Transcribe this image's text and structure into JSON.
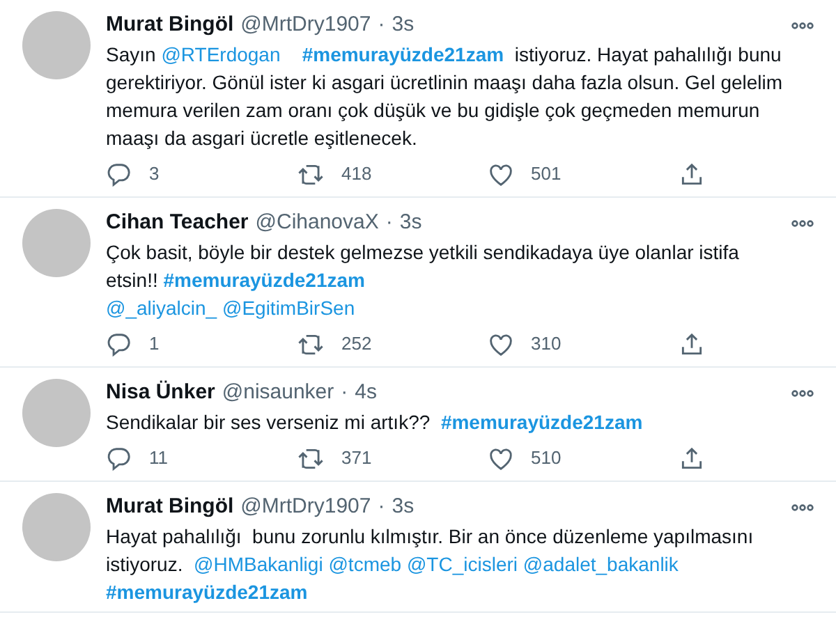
{
  "tweets": [
    {
      "name": "Murat Bingöl",
      "handle": "@MrtDry1907",
      "separator": "·",
      "time": "3s",
      "body": [
        {
          "kind": "text",
          "text": "Sayın "
        },
        {
          "kind": "mention",
          "text": "@RTErdogan"
        },
        {
          "kind": "hashtag",
          "text": "#memurayüzde21zam"
        },
        {
          "kind": "text",
          "text": "  istiyoruz. Hayat pahalılığı bunu gerektiriyor. Gönül ister ki asgari ücretlinin maaşı daha fazla olsun. Gel gelelim memura verilen zam oranı çok düşük ve bu gidişle çok geçmeden memurun maaşı da asgari ücretle eşitlenecek."
        }
      ],
      "replies": "3",
      "retweets": "418",
      "likes": "501"
    },
    {
      "name": "Cihan Teacher",
      "handle": "@CihanovaX",
      "separator": "·",
      "time": "3s",
      "body": [
        {
          "kind": "text",
          "text": "Çok basit, böyle bir destek gelmezse yetkili sendikadaya üye olanlar istifa etsin!! "
        },
        {
          "kind": "hashtag",
          "text": "#memurayüzde21zam"
        },
        {
          "kind": "break"
        },
        {
          "kind": "mention",
          "text": "@_aliyalcin_"
        },
        {
          "kind": "mention",
          "text": "@EgitimBirSen"
        }
      ],
      "replies": "1",
      "retweets": "252",
      "likes": "310"
    },
    {
      "name": "Nisa Ünker",
      "handle": "@nisaunker",
      "separator": "·",
      "time": "4s",
      "body": [
        {
          "kind": "text",
          "text": "Sendikalar bir ses verseniz mi artık??  "
        },
        {
          "kind": "hashtag",
          "text": "#memurayüzde21zam"
        }
      ],
      "replies": "11",
      "retweets": "371",
      "likes": "510"
    },
    {
      "name": "Murat Bingöl",
      "handle": "@MrtDry1907",
      "separator": "·",
      "time": "3s",
      "body": [
        {
          "kind": "text",
          "text": "Hayat pahalılığı  bunu zorunlu kılmıştır. Bir an önce düzenleme yapılmasını istiyoruz.  "
        },
        {
          "kind": "mention",
          "text": "@HMBakanligi"
        },
        {
          "kind": "mention",
          "text": "@tcmeb"
        },
        {
          "kind": "mention",
          "text": "@TC_icisleri"
        },
        {
          "kind": "mention",
          "text": "@adalet_bakanlik"
        },
        {
          "kind": "break"
        },
        {
          "kind": "hashtag",
          "text": "#memurayüzde21zam"
        }
      ]
    }
  ]
}
